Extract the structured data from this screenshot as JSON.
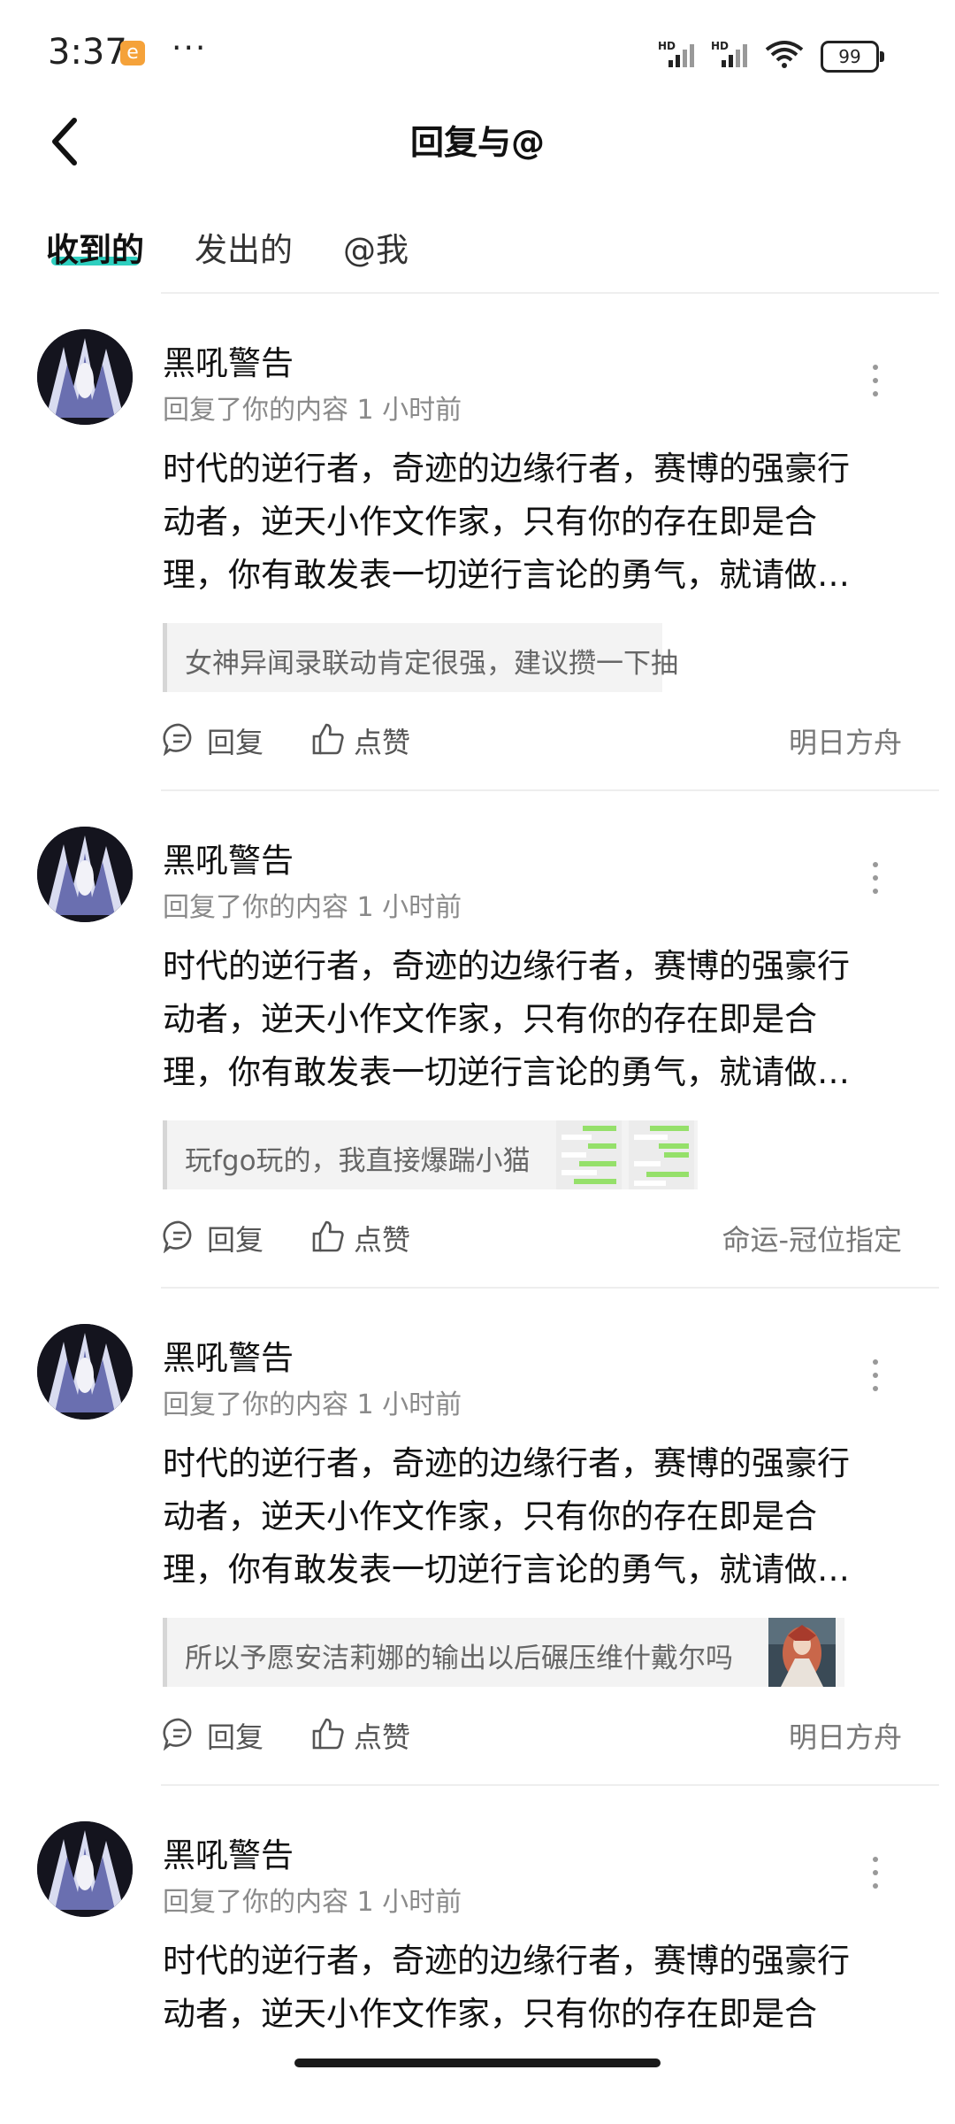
{
  "status_bar": {
    "time": "3:37",
    "app_icon": "e",
    "more": "···",
    "signal1": "HD",
    "signal2": "HD",
    "battery": "99"
  },
  "header": {
    "title": "回复与@"
  },
  "tabs": [
    {
      "label": "收到的",
      "active": true
    },
    {
      "label": "发出的",
      "active": false
    },
    {
      "label": "@我",
      "active": false
    }
  ],
  "items": [
    {
      "username": "黑吼警告",
      "meta": "回复了你的内容 1 小时前",
      "content": [
        "时代的逆行者，奇迹的边缘行者，赛博的强豪行",
        "动者，逆天小作文作家，只有你的存在即是合",
        "理，你有敢发表一切逆行言论的勇气，就请做…"
      ],
      "quote": "女神异闻录联动肯定很强，建议攒一下抽",
      "reply_label": "回复",
      "like_label": "点赞",
      "source": "明日方舟"
    },
    {
      "username": "黑吼警告",
      "meta": "回复了你的内容 1 小时前",
      "content": [
        "时代的逆行者，奇迹的边缘行者，赛博的强豪行",
        "动者，逆天小作文作家，只有你的存在即是合",
        "理，你有敢发表一切逆行言论的勇气，就请做…"
      ],
      "quote": "玩fgo玩的，我直接爆踹小猫",
      "reply_label": "回复",
      "like_label": "点赞",
      "source": "命运-冠位指定"
    },
    {
      "username": "黑吼警告",
      "meta": "回复了你的内容 1 小时前",
      "content": [
        "时代的逆行者，奇迹的边缘行者，赛博的强豪行",
        "动者，逆天小作文作家，只有你的存在即是合",
        "理，你有敢发表一切逆行言论的勇气，就请做…"
      ],
      "quote": "所以予愿安洁莉娜的输出以后碾压维什戴尔吗",
      "reply_label": "回复",
      "like_label": "点赞",
      "source": "明日方舟"
    },
    {
      "username": "黑吼警告",
      "meta": "回复了你的内容 1 小时前",
      "content": [
        "时代的逆行者，奇迹的边缘行者，赛博的强豪行",
        "动者，逆天小作文作家，只有你的存在即是合"
      ]
    }
  ],
  "colors": {
    "accent": "#2ecfbf",
    "quote_bg": "#f3f3f3",
    "meta_text": "#8a8a8a"
  }
}
